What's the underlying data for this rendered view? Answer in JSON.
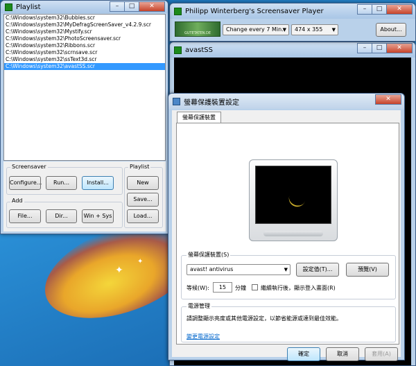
{
  "playlist": {
    "title": "Playlist",
    "items": [
      "C:\\Windows\\system32\\Bubbles.scr",
      "C:\\Windows\\system32\\MyDefragScreenSaver_v4.2.9.scr",
      "C:\\Windows\\system32\\Mystify.scr",
      "C:\\Windows\\system32\\PhotoScreensaver.scr",
      "C:\\Windows\\system32\\Ribbons.scr",
      "C:\\Windows\\system32\\scrnsave.scr",
      "C:\\Windows\\system32\\ssText3d.scr",
      "C:\\Windows\\system32\\avastSS.scr"
    ],
    "screensaver_group": "Screensaver",
    "configure": "Configure...",
    "run": "Run...",
    "install": "Install...",
    "add_group": "Add",
    "file": "File...",
    "dir": "Dir...",
    "win_sys": "Win + Sys",
    "playlist_group": "Playlist",
    "new": "New",
    "save": "Save...",
    "load": "Load..."
  },
  "player": {
    "title": "Philipp Winterberg's Screensaver Player",
    "thumb_text": "GUTETATEN.DE",
    "interval": "Change every 7 Min.",
    "resolution": "474 x 355",
    "about": "About..."
  },
  "avast": {
    "title": "avastSS"
  },
  "dialog": {
    "title": "螢幕保護裝置設定",
    "tab": "螢幕保護裝置",
    "ss_group": "螢幕保護裝置(S)",
    "ss_selected": "avast! antivirus",
    "settings_btn": "設定值(T)...",
    "preview_btn": "預覽(V)",
    "wait_label": "等候(W):",
    "wait_value": "15",
    "minutes": "分鐘",
    "resume_label": "繼續執行後，顯示登入畫面(R)",
    "power_group": "電源管理",
    "power_text": "請調整顯示亮度或其他電源設定，以節省能源或達到最佳效能。",
    "power_link": "變更電源設定",
    "ok": "確定",
    "cancel": "取消",
    "apply": "套用(A)"
  }
}
